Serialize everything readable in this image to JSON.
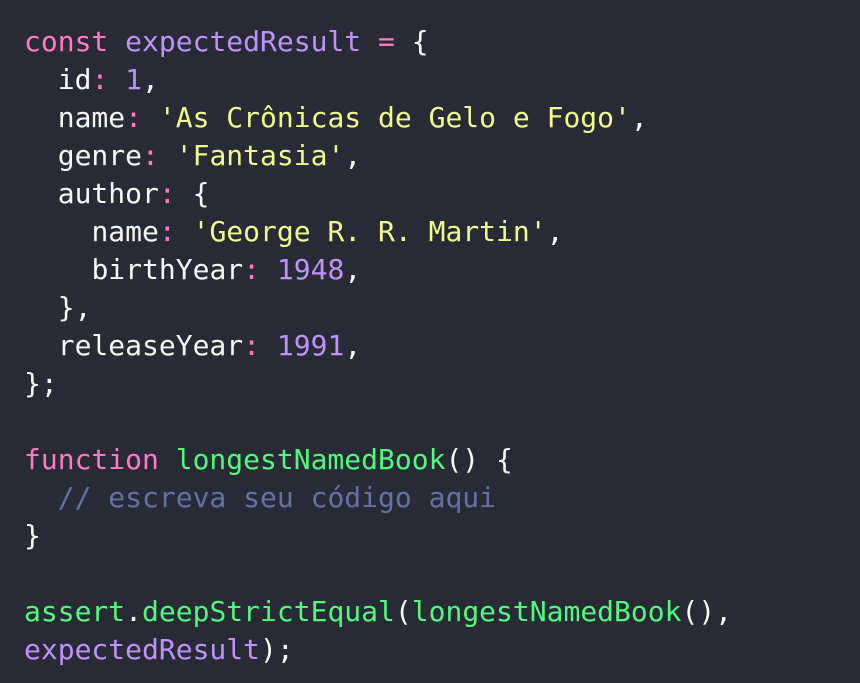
{
  "colors": {
    "background": "#282a36",
    "foreground": "#f8f8f2",
    "keyword": "#ff79c6",
    "variable": "#bd93f9",
    "number": "#bd93f9",
    "string": "#f1fa8c",
    "function": "#50fa7b",
    "comment": "#6272a4"
  },
  "code": {
    "lines": [
      [
        {
          "t": "keyword",
          "v": "const"
        },
        {
          "t": "plain",
          "v": " "
        },
        {
          "t": "variable",
          "v": "expectedResult"
        },
        {
          "t": "plain",
          "v": " "
        },
        {
          "t": "operator",
          "v": "="
        },
        {
          "t": "plain",
          "v": " {"
        }
      ],
      [
        {
          "t": "plain",
          "v": "  "
        },
        {
          "t": "property",
          "v": "id"
        },
        {
          "t": "operator",
          "v": ":"
        },
        {
          "t": "plain",
          "v": " "
        },
        {
          "t": "number",
          "v": "1"
        },
        {
          "t": "plain",
          "v": ","
        }
      ],
      [
        {
          "t": "plain",
          "v": "  "
        },
        {
          "t": "property",
          "v": "name"
        },
        {
          "t": "operator",
          "v": ":"
        },
        {
          "t": "plain",
          "v": " "
        },
        {
          "t": "string",
          "v": "'As Crônicas de Gelo e Fogo'"
        },
        {
          "t": "plain",
          "v": ","
        }
      ],
      [
        {
          "t": "plain",
          "v": "  "
        },
        {
          "t": "property",
          "v": "genre"
        },
        {
          "t": "operator",
          "v": ":"
        },
        {
          "t": "plain",
          "v": " "
        },
        {
          "t": "string",
          "v": "'Fantasia'"
        },
        {
          "t": "plain",
          "v": ","
        }
      ],
      [
        {
          "t": "plain",
          "v": "  "
        },
        {
          "t": "property",
          "v": "author"
        },
        {
          "t": "operator",
          "v": ":"
        },
        {
          "t": "plain",
          "v": " {"
        }
      ],
      [
        {
          "t": "plain",
          "v": "    "
        },
        {
          "t": "property",
          "v": "name"
        },
        {
          "t": "operator",
          "v": ":"
        },
        {
          "t": "plain",
          "v": " "
        },
        {
          "t": "string",
          "v": "'George R. R. Martin'"
        },
        {
          "t": "plain",
          "v": ","
        }
      ],
      [
        {
          "t": "plain",
          "v": "    "
        },
        {
          "t": "property",
          "v": "birthYear"
        },
        {
          "t": "operator",
          "v": ":"
        },
        {
          "t": "plain",
          "v": " "
        },
        {
          "t": "number",
          "v": "1948"
        },
        {
          "t": "plain",
          "v": ","
        }
      ],
      [
        {
          "t": "plain",
          "v": "  },"
        }
      ],
      [
        {
          "t": "plain",
          "v": "  "
        },
        {
          "t": "property",
          "v": "releaseYear"
        },
        {
          "t": "operator",
          "v": ":"
        },
        {
          "t": "plain",
          "v": " "
        },
        {
          "t": "number",
          "v": "1991"
        },
        {
          "t": "plain",
          "v": ","
        }
      ],
      [
        {
          "t": "plain",
          "v": "};"
        }
      ],
      [],
      [
        {
          "t": "keyword",
          "v": "function"
        },
        {
          "t": "plain",
          "v": " "
        },
        {
          "t": "function",
          "v": "longestNamedBook"
        },
        {
          "t": "plain",
          "v": "() {"
        }
      ],
      [
        {
          "t": "plain",
          "v": "  "
        },
        {
          "t": "comment",
          "v": "// escreva seu código aqui"
        }
      ],
      [
        {
          "t": "plain",
          "v": "}"
        }
      ],
      [],
      [
        {
          "t": "function",
          "v": "assert"
        },
        {
          "t": "plain",
          "v": "."
        },
        {
          "t": "function",
          "v": "deepStrictEqual"
        },
        {
          "t": "plain",
          "v": "("
        },
        {
          "t": "function",
          "v": "longestNamedBook"
        },
        {
          "t": "plain",
          "v": "(),"
        }
      ],
      [
        {
          "t": "variable",
          "v": "expectedResult"
        },
        {
          "t": "plain",
          "v": ");"
        }
      ]
    ]
  }
}
